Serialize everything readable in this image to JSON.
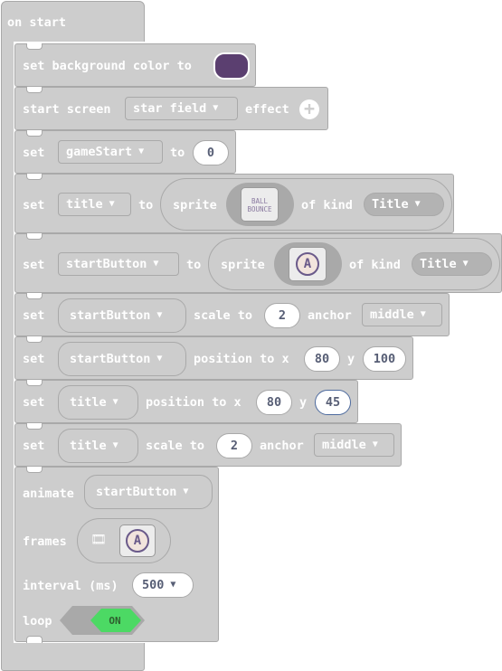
{
  "hat": {
    "label": "on start"
  },
  "blocks": {
    "bg": {
      "label": "set background color to",
      "color": "#5b3f70"
    },
    "effect": {
      "label1": "start screen",
      "effect": "star field",
      "label2": "effect"
    },
    "game_start": {
      "set": "set",
      "var": "gameStart",
      "to": "to",
      "value": "0"
    },
    "title_sprite": {
      "set": "set",
      "var": "title",
      "to": "to",
      "sprite": "sprite",
      "image_text": "BALL BOUNCE",
      "of_kind": "of kind",
      "kind": "Title"
    },
    "start_sprite": {
      "set": "set",
      "var": "startButton",
      "to": "to",
      "sprite": "sprite",
      "image_text": "A",
      "of_kind": "of kind",
      "kind": "Title"
    },
    "start_scale": {
      "set": "set",
      "var": "startButton",
      "label": "scale to",
      "value": "2",
      "anchor": "anchor",
      "anchor_value": "middle"
    },
    "start_pos": {
      "set": "set",
      "var": "startButton",
      "label": "position to x",
      "x": "80",
      "y_label": "y",
      "y": "100"
    },
    "title_pos": {
      "set": "set",
      "var": "title",
      "label": "position to x",
      "x": "80",
      "y_label": "y",
      "y": "45"
    },
    "title_scale": {
      "set": "set",
      "var": "title",
      "label": "scale to",
      "value": "2",
      "anchor": "anchor",
      "anchor_value": "middle"
    },
    "animate": {
      "label": "animate",
      "var": "startButton",
      "frames": "frames",
      "frame_text": "A",
      "interval": "interval (ms)",
      "interval_value": "500",
      "loop": "loop",
      "loop_value": "ON"
    }
  },
  "colors": {
    "block": "#cdcdcd",
    "toggle_on": "#4cd964",
    "swatch": "#5b3f70"
  }
}
